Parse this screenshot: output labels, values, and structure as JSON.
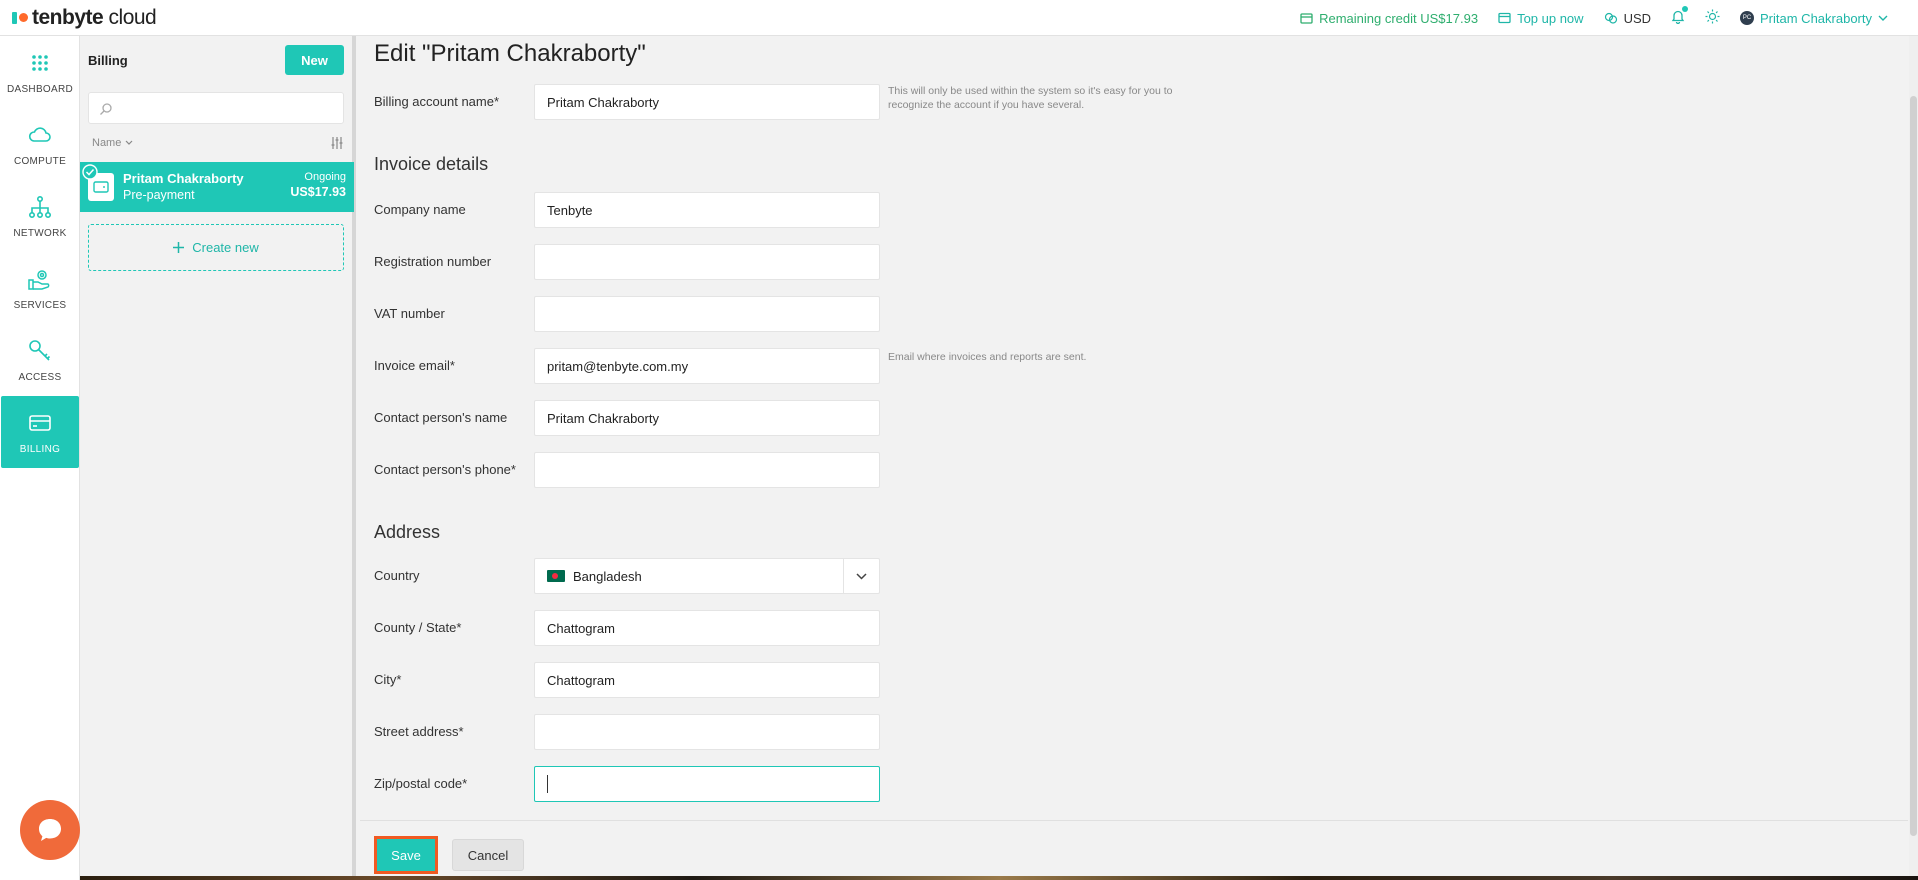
{
  "brand": {
    "logo_bold": "tenbyte",
    "logo_light": " cloud"
  },
  "topbar": {
    "credit": "Remaining credit US$17.93",
    "topup": "Top up now",
    "currency": "USD",
    "user": "Pritam Chakraborty",
    "avatar_initials": "PC"
  },
  "nav": [
    {
      "label": "DASHBOARD"
    },
    {
      "label": "COMPUTE"
    },
    {
      "label": "NETWORK"
    },
    {
      "label": "SERVICES"
    },
    {
      "label": "ACCESS"
    },
    {
      "label": "BILLING"
    }
  ],
  "billing": {
    "title": "Billing",
    "new_label": "New",
    "list_header": "Name",
    "account": {
      "name": "Pritam Chakraborty",
      "type": "Pre-payment",
      "status": "Ongoing",
      "amount": "US$17.93"
    },
    "create_label": "Create new"
  },
  "form": {
    "title": "Edit \"Pritam Chakraborty\"",
    "account_name": {
      "label": "Billing account name*",
      "value": "Pritam Chakraborty",
      "hint": "This will only be used within the system so it's easy for you to recognize the account if you have several."
    },
    "invoice_section": "Invoice details",
    "company": {
      "label": "Company name",
      "value": "Tenbyte"
    },
    "registration": {
      "label": "Registration number",
      "value": ""
    },
    "vat": {
      "label": "VAT number",
      "value": ""
    },
    "email": {
      "label": "Invoice email*",
      "value": "pritam@tenbyte.com.my",
      "hint": "Email where invoices and reports are sent."
    },
    "contact_name": {
      "label": "Contact person's name",
      "value": "Pritam Chakraborty"
    },
    "contact_phone": {
      "label": "Contact person's phone*",
      "value": ""
    },
    "address_section": "Address",
    "country": {
      "label": "Country",
      "value": "Bangladesh"
    },
    "state": {
      "label": "County / State*",
      "value": "Chattogram"
    },
    "city": {
      "label": "City*",
      "value": "Chattogram"
    },
    "street": {
      "label": "Street address*",
      "value": ""
    },
    "zip": {
      "label": "Zip/postal code*",
      "value": ""
    }
  },
  "footer": {
    "save": "Save",
    "cancel": "Cancel"
  },
  "colors": {
    "accent": "#1fc7b6",
    "highlight": "#f05a22",
    "credit": "#2eae6e"
  }
}
